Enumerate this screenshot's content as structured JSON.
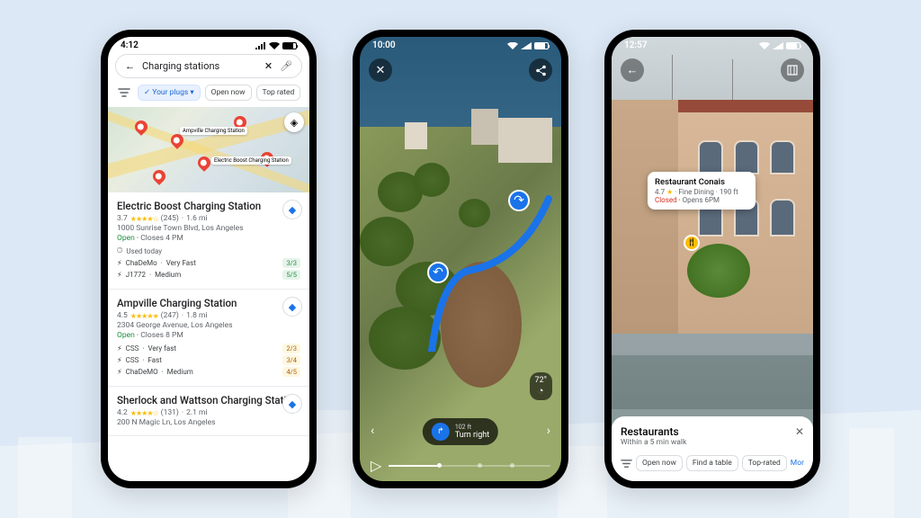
{
  "phone1": {
    "time": "4:12",
    "search": {
      "placeholder": "Charging stations",
      "value": "Charging stations"
    },
    "filters": {
      "your_plugs": "Your plugs",
      "open_now": "Open now",
      "top_rated": "Top rated"
    },
    "map_labels": {
      "ampville": "Ampville Charging Station",
      "electric": "Electric Boost Charging Station"
    },
    "results": [
      {
        "name": "Electric Boost Charging Station",
        "rating": "3.7",
        "reviews": "(245)",
        "distance": "1.6 mi",
        "address": "1000 Sunrise Town Blvd, Los Angeles",
        "status_open": "Open",
        "status_close": "Closes 4 PM",
        "used": "Used today",
        "plugs": [
          {
            "type": "ChaDeMo",
            "speed": "Very Fast",
            "count": "3/3",
            "cls": "pc-green"
          },
          {
            "type": "J1772",
            "speed": "Medium",
            "count": "5/5",
            "cls": "pc-green"
          }
        ]
      },
      {
        "name": "Ampville Charging Station",
        "rating": "4.5",
        "reviews": "(247)",
        "distance": "1.8 mi",
        "address": "2304 George Avenue, Los Angeles",
        "status_open": "Open",
        "status_close": "Closes 8 PM",
        "plugs": [
          {
            "type": "CSS",
            "speed": "Very fast",
            "count": "2/3",
            "cls": "pc-yellow"
          },
          {
            "type": "CSS",
            "speed": "Fast",
            "count": "3/4",
            "cls": "pc-yellow"
          },
          {
            "type": "ChaDeMO",
            "speed": "Medium",
            "count": "4/5",
            "cls": "pc-yellow"
          }
        ]
      },
      {
        "name": "Sherlock and Wattson Charging Station",
        "rating": "4.2",
        "reviews": "(131)",
        "distance": "2.1 mi",
        "address": "200 N Magic Ln, Los Angeles"
      }
    ]
  },
  "phone2": {
    "time": "10:00",
    "temp": "72°",
    "nav": {
      "distance": "102 ft",
      "instruction": "Turn right"
    }
  },
  "phone3": {
    "time": "12:57",
    "poi": {
      "name": "Restaurant Conais",
      "rating": "4.7",
      "category": "Fine Dining",
      "distance": "190 ft",
      "status_closed": "Closed",
      "opens": "Opens 6PM"
    },
    "bottom": {
      "title": "Restaurants",
      "subtitle": "Within a 5 min walk",
      "chips": {
        "open_now": "Open now",
        "find_table": "Find a table",
        "top_rated": "Top-rated",
        "more": "More"
      }
    }
  }
}
